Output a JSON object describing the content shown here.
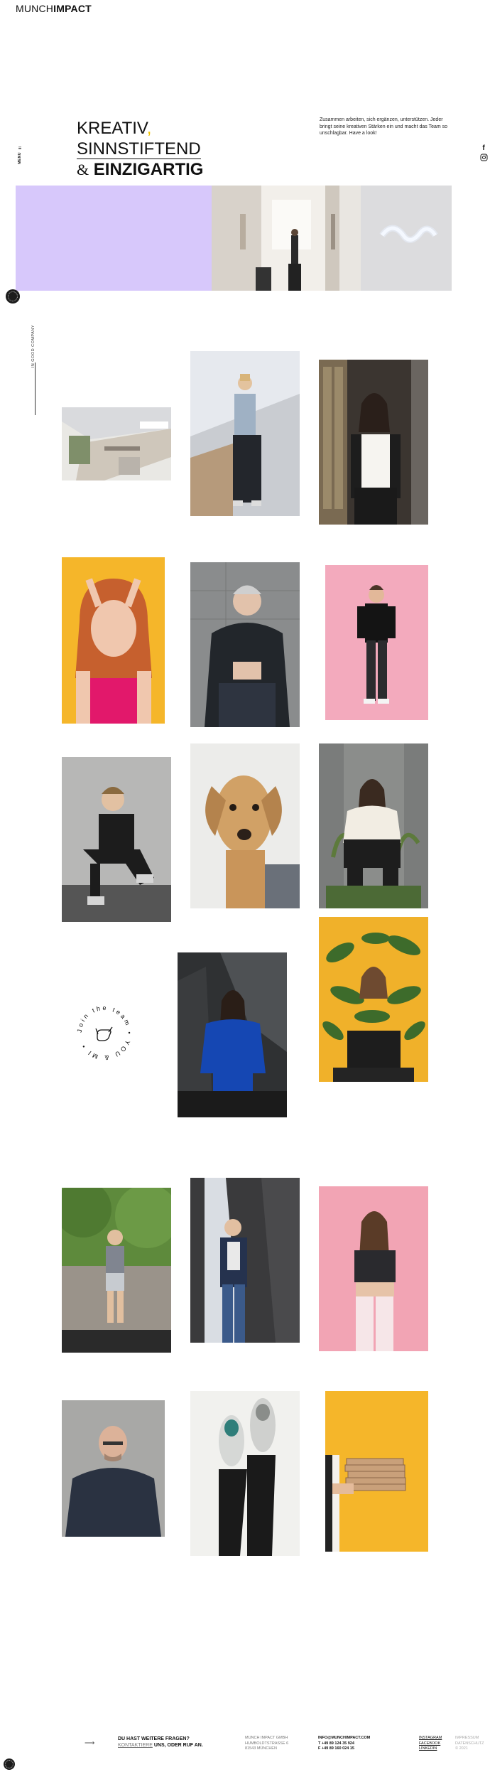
{
  "header": {
    "logo_light": "MUNCH",
    "logo_bold": "IMPACT",
    "menu_label": "MENU"
  },
  "social": [
    "f-icon",
    "instagram-icon"
  ],
  "hero": {
    "line1": "KREATIV",
    "line1_comma": ",",
    "line2": "SINNSTIFTEND",
    "line3_amp": "&",
    "line3": "EINZIGARTIG",
    "intro": "Zusammen arbeiten, sich ergänzen, unterstützen. Jeder bringt seine kreativen Stärken ein und macht das Team so unschlagbar. Have a look!"
  },
  "side_label": "IN GOOD COMPANY",
  "badge": {
    "text": "Join the team • YOU & MI •",
    "icon": "shaka-hand-icon"
  },
  "footer": {
    "question": "DU HAST WEITERE FRAGEN?",
    "cta_light": "KONTAKTIERE",
    "cta_bold": "UNS, ODER RUF AN.",
    "address": [
      "MUNCH IMPACT GMBH",
      "HUMBOLDTSTRASSE 6",
      "81543 MÜNCHEN"
    ],
    "contact": [
      "INFO@MUNCHIMPACT.COM",
      "T +49 89 124 35 924",
      "F +49 89 160 024 15"
    ],
    "links": [
      "INSTAGRAM",
      "FACEBOOK",
      "LINKEDIN"
    ],
    "legal": [
      "IMPRESSUM",
      "DATENSCHUTZ",
      "© 2021"
    ]
  },
  "colors": {
    "lavender": "#d7c8fb",
    "yellow": "#f5b62a",
    "pink": "#f3aabd",
    "accent_comma": "#f2c400"
  }
}
